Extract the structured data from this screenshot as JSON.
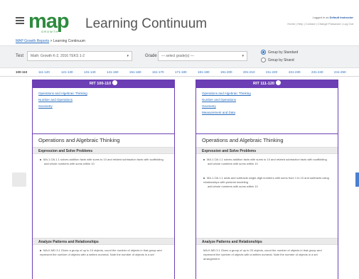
{
  "header": {
    "logo": "map",
    "logo_sub": "GROWTH",
    "app_title": "Learning Continuum",
    "user_line1_prefix": "Logged in as",
    "user_line1_name": "Default Instructor",
    "user_line2": "Home | Help | Contact | Change Password | Log Out"
  },
  "breadcrumb": {
    "link": "MAP Growth Reports",
    "separator": ">",
    "current": "Learning Continuum"
  },
  "filters": {
    "test_label": "Test",
    "test_value": "Math: Growth K-2, 2016 TEKS 1-2",
    "grade_label": "Grade",
    "grade_value": "— select grade(s) —",
    "radio_standard": "Group by Standard",
    "radio_strand": "Group by Strand"
  },
  "rit_tabs": [
    "100-110",
    "111-120",
    "121-130",
    "131-140",
    "141-150",
    "151-160",
    "161-170",
    "171-180",
    "181-190",
    "191-200",
    "201-210",
    "211-220",
    "221-230",
    "231-240",
    "241-250"
  ],
  "columns": [
    {
      "header": "RIT 100-110",
      "links": [
        "Operations and Algebraic Thinking",
        "Number and Operations",
        "Geometry"
      ],
      "strand": "Operations and Algebraic Thinking",
      "sub_head_1": "Expression and Solve Problems",
      "skills_1": [
        {
          "text": "MA.1.OA.1.1 solves addition facts with sums to 10 and related subtraction facts with scaffolding",
          "sub": "add whole numbers with sums within 10"
        }
      ],
      "sub_head_2": "Analyze Patterns and Relationships",
      "skills_2": [
        {
          "text": "MA.K.MD.3.1 Given a group of up to 10 objects, count the number of objects in that group and represent the number of objects with a written numeral. Note the number of objects in a set",
          "sub": ""
        }
      ]
    },
    {
      "header": "RIT 111-120",
      "links": [
        "Operations and Algebraic Thinking",
        "Number and Operations",
        "Geometry",
        "Measurement and Data"
      ],
      "strand": "Operations and Algebraic Thinking",
      "sub_head_1": "Expression and Solve Problems",
      "skills_1": [
        {
          "text": "MA.1.OA.1.1 solves addition facts with sums to 10 and related subtraction facts with scaffolding",
          "sub": "add whole numbers with sums within 10"
        },
        {
          "text": "MA.1.OA.1.1 adds and subtracts single-digit numbers with sums from 1 to 10 and subtracts using relationships with pictorial modeling",
          "sub": "add whole numbers with sums within 10"
        }
      ],
      "sub_head_2": "Analyze Patterns and Relationships",
      "skills_2": [
        {
          "text": "MA.K.MD.3.1 Given a group of up to 20 objects, count the number of objects in that group and represent the number of objects with a written numeral. Note the number of objects in a set arrangement",
          "sub": ""
        }
      ]
    }
  ],
  "colors": {
    "brand_green": "#2e8b3e",
    "column_purple": "#6c3fb5",
    "link_blue": "#2a6ebd"
  }
}
